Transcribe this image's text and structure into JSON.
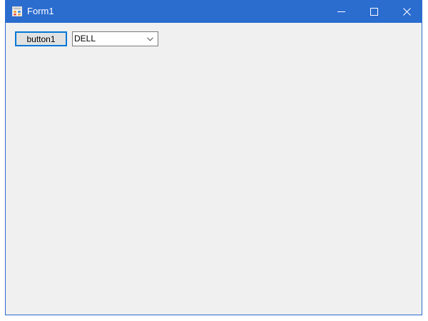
{
  "window": {
    "title": "Form1",
    "icon": "winforms-app-icon",
    "controls": {
      "minimize_icon": "minimize-icon",
      "maximize_icon": "maximize-icon",
      "close_icon": "close-icon"
    },
    "colors": {
      "titlebar": "#2b6ccf",
      "client_background": "#f0f0f0"
    }
  },
  "form": {
    "button1_label": "button1",
    "combobox": {
      "selected_value": "DELL",
      "arrow_icon": "chevron-down-icon"
    }
  }
}
